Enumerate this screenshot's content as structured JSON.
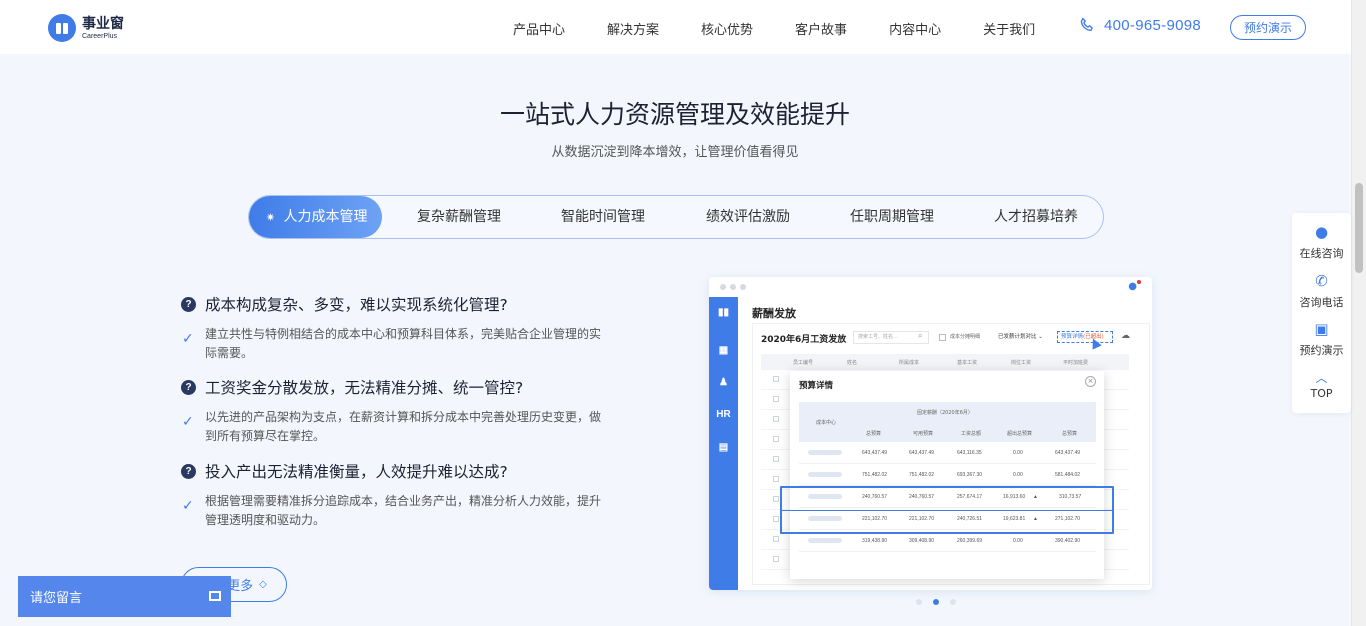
{
  "header": {
    "logo_cn": "事业窗",
    "logo_en": "CareerPlus",
    "nav": [
      "产品中心",
      "解决方案",
      "核心优势",
      "客户故事",
      "内容中心",
      "关于我们"
    ],
    "phone": "400-965-9098",
    "demo_button": "预约演示"
  },
  "section": {
    "title": "一站式人力资源管理及效能提升",
    "subtitle": "从数据沉淀到降本增效，让管理价值看得见"
  },
  "tabs": [
    "人力成本管理",
    "复杂薪酬管理",
    "智能时间管理",
    "绩效评估激励",
    "任职周期管理",
    "人才招募培养"
  ],
  "features": [
    {
      "title": "成本构成复杂、多变，难以实现系统化管理?",
      "desc": "建立共性与特例相结合的成本中心和预算科目体系，完美贴合企业管理的实际需要。"
    },
    {
      "title": "工资奖金分散发放，无法精准分摊、统一管控?",
      "desc": "以先进的产品架构为支点，在薪资计算和拆分成本中完善处理历史变更，做到所有预算尽在掌控。"
    },
    {
      "title": "投入产出无法精准衡量，人效提升难以达成?",
      "desc": "根据管理需要精准拆分追踪成本，结合业务产出，精准分析人力效能，提升管理透明度和驱动力。"
    }
  ],
  "more_button": "了解更多",
  "chat_bar": "请您留言",
  "float_tools": {
    "online": "在线咨询",
    "phone": "咨询电话",
    "demo": "预约演示",
    "top": "TOP"
  },
  "mockup": {
    "page_title": "薪酬发放",
    "card_title": "2020年6月工资发放",
    "search_placeholder": "搜索工号、姓名...",
    "option_1": "成本分摊明细",
    "select": "已发薪计划对比",
    "link": "预算详情",
    "link_sub": "(已超出)",
    "bg_headers": [
      "员工编号",
      "姓名",
      "所属成本",
      "基本工资",
      "岗位工资",
      "平时加班费"
    ],
    "popup": {
      "title": "预算详情",
      "col_center": "成本中心",
      "group_header": "固定薪酬（2020年6月）",
      "sub_headers": [
        "总预算",
        "可用预算",
        "工资总额",
        "超出总预算",
        "总预算"
      ],
      "rows": [
        [
          "643,437.49",
          "643,437.49",
          "643,116.35",
          "0.00",
          "643,437.49"
        ],
        [
          "751,482.02",
          "751,482.02",
          "693,367.30",
          "0.00",
          "581,484.02"
        ],
        [
          "240,760.57",
          "240,760.57",
          "257,674.17",
          "16,913.60",
          "310,73.57"
        ],
        [
          "221,102.70",
          "221,102.70",
          "240,726.51",
          "19,623.81",
          "271,102.70"
        ],
        [
          "319,438.90",
          "309,408.90",
          "260,399.69",
          "0.00",
          "390,402.90"
        ]
      ]
    }
  },
  "colors": {
    "accent": "#3f7ce8",
    "navy": "#2a3960",
    "warning": "#f0a020"
  }
}
